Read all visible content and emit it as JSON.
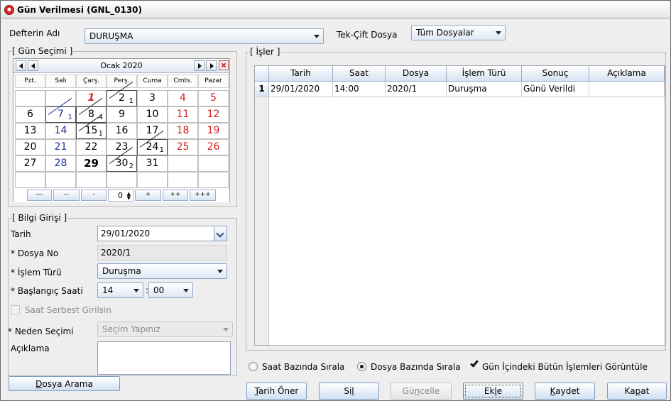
{
  "window": {
    "title": "Gün Verilmesi (GNL_0130)"
  },
  "top": {
    "defter_label": "Defterin Adı",
    "defter_value": "DURUŞMA",
    "tekcift_label": "Tek-Çift Dosya",
    "tekcift_value": "Tüm Dosyalar"
  },
  "calendar": {
    "group_title": "[ Gün Seçimi ]",
    "month_label": "Ocak 2020",
    "weekdays": [
      "Pzt.",
      "Salı",
      "Çarş.",
      "Perş.",
      "Cuma",
      "Cmts.",
      "Pazar"
    ],
    "weeks": [
      [
        "",
        "",
        "1",
        "2",
        "3",
        "4",
        "5"
      ],
      [
        "6",
        "7",
        "8",
        "9",
        "10",
        "11",
        "12"
      ],
      [
        "13",
        "14",
        "15",
        "16",
        "17",
        "18",
        "19"
      ],
      [
        "20",
        "21",
        "22",
        "23",
        "24",
        "25",
        "26"
      ],
      [
        "27",
        "28",
        "29",
        "30",
        "31",
        "",
        ""
      ],
      [
        "",
        "",
        "",
        "",
        "",
        "",
        ""
      ]
    ],
    "counts": {
      "2": "1",
      "7": "1",
      "8": "4",
      "15": "1",
      "24": "1",
      "30": "2"
    },
    "today": "29",
    "nav_buttons": [
      "---",
      "--",
      "-",
      "+",
      "++",
      "+++"
    ],
    "offset_value": "0"
  },
  "bilgi": {
    "group_title": "[ Bilgi Girişi ]",
    "tarih_label": "Tarih",
    "tarih_value": "29/01/2020",
    "dosya_label": "* Dosya No",
    "dosya_value": "2020/1",
    "islem_label": "* İşlem Türü",
    "islem_value": "Duruşma",
    "saat_label": "* Başlangıç Saati",
    "saat_hour": "14",
    "saat_sep": ":",
    "saat_min": "00",
    "serbest_label": "Saat Serbest Girilsin",
    "neden_label": "* Neden Seçimi",
    "neden_placeholder": "Seçim Yapınız",
    "aciklama_label": "Açıklama",
    "dosya_arama_pre": "",
    "dosya_arama_ul": "D",
    "dosya_arama_post": "osya Arama"
  },
  "isler": {
    "group_title": "[ İşler ]",
    "columns": [
      "Tarih",
      "Saat",
      "Dosya",
      "İşlem Türü",
      "Sonuç",
      "Açıklama"
    ],
    "rows": [
      {
        "index": "1",
        "cells": [
          "29/01/2020",
          "14:00",
          "2020/1",
          "Duruşma",
          "Günü Verildi",
          ""
        ]
      }
    ]
  },
  "options": {
    "saat_bazinda": "Saat Bazında Sırala",
    "dosya_bazinda": "Dosya Bazında Sırala",
    "gun_icindeki": "Gün İçindeki Bütün İşlemleri Görüntüle"
  },
  "buttons": {
    "tarih_oner_ul": "T",
    "tarih_oner_post": "arih Öner",
    "sil_pre": "Si",
    "sil_ul": "l",
    "sil_post": "",
    "guncelle_pre": "Gü",
    "guncelle_ul": "n",
    "guncelle_post": "celle",
    "ekle_pre": "Ek",
    "ekle_ul": "l",
    "ekle_post": "e",
    "kaydet_ul": "K",
    "kaydet_post": "aydet",
    "kapat_pre": "Ka",
    "kapat_ul": "p",
    "kapat_post": "at"
  }
}
